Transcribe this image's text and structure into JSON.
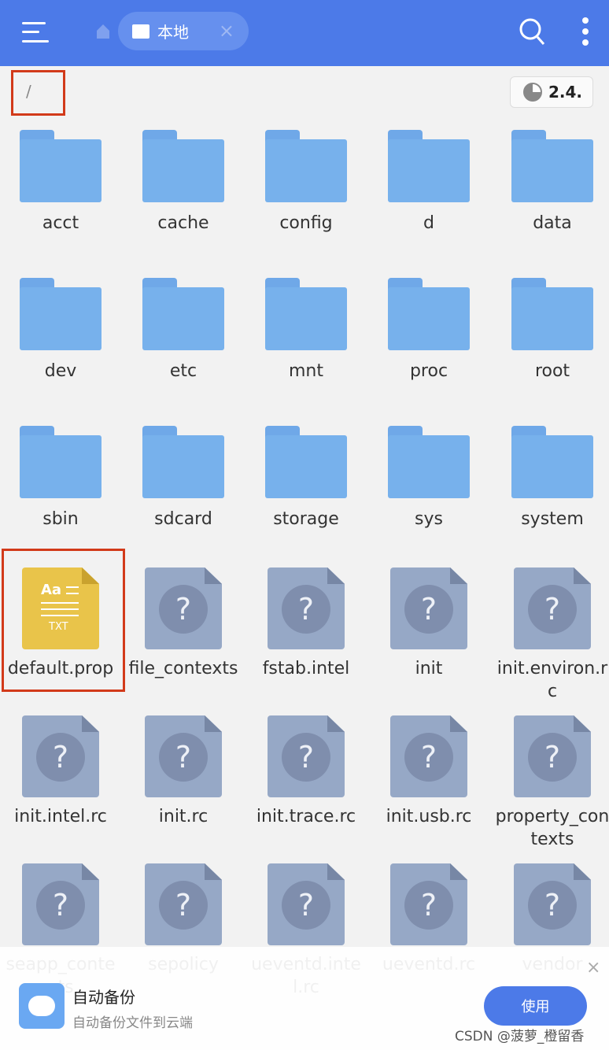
{
  "header": {
    "tab_label": "本地",
    "tab_close": "×"
  },
  "path": "/",
  "storage": "2.4.",
  "items": [
    {
      "name": "acct",
      "type": "folder"
    },
    {
      "name": "cache",
      "type": "folder"
    },
    {
      "name": "config",
      "type": "folder"
    },
    {
      "name": "d",
      "type": "folder"
    },
    {
      "name": "data",
      "type": "folder"
    },
    {
      "name": "dev",
      "type": "folder"
    },
    {
      "name": "etc",
      "type": "folder"
    },
    {
      "name": "mnt",
      "type": "folder"
    },
    {
      "name": "proc",
      "type": "folder"
    },
    {
      "name": "root",
      "type": "folder"
    },
    {
      "name": "sbin",
      "type": "folder"
    },
    {
      "name": "sdcard",
      "type": "folder"
    },
    {
      "name": "storage",
      "type": "folder"
    },
    {
      "name": "sys",
      "type": "folder"
    },
    {
      "name": "system",
      "type": "folder"
    },
    {
      "name": "default.prop",
      "type": "txt"
    },
    {
      "name": "file_contexts",
      "type": "unknown"
    },
    {
      "name": "fstab.intel",
      "type": "unknown"
    },
    {
      "name": "init",
      "type": "unknown"
    },
    {
      "name": "init.environ.rc",
      "type": "unknown"
    },
    {
      "name": "init.intel.rc",
      "type": "unknown"
    },
    {
      "name": "init.rc",
      "type": "unknown"
    },
    {
      "name": "init.trace.rc",
      "type": "unknown"
    },
    {
      "name": "init.usb.rc",
      "type": "unknown"
    },
    {
      "name": "property_contexts",
      "type": "unknown"
    },
    {
      "name": "seapp_contexts",
      "type": "unknown"
    },
    {
      "name": "sepolicy",
      "type": "unknown"
    },
    {
      "name": "ueventd.intel.rc",
      "type": "unknown"
    },
    {
      "name": "ueventd.rc",
      "type": "unknown"
    },
    {
      "name": "vendor",
      "type": "unknown"
    }
  ],
  "txt_icon": {
    "aa": "Aa",
    "ext": "TXT"
  },
  "unknown_icon": "?",
  "banner": {
    "title": "自动备份",
    "subtitle": "自动备份文件到云端",
    "button": "使用",
    "close": "×"
  },
  "watermark": "CSDN @菠萝_橙留香",
  "colors": {
    "accent": "#4c7ae8",
    "folder": "#77b1ec",
    "highlight": "#d23a1a"
  }
}
